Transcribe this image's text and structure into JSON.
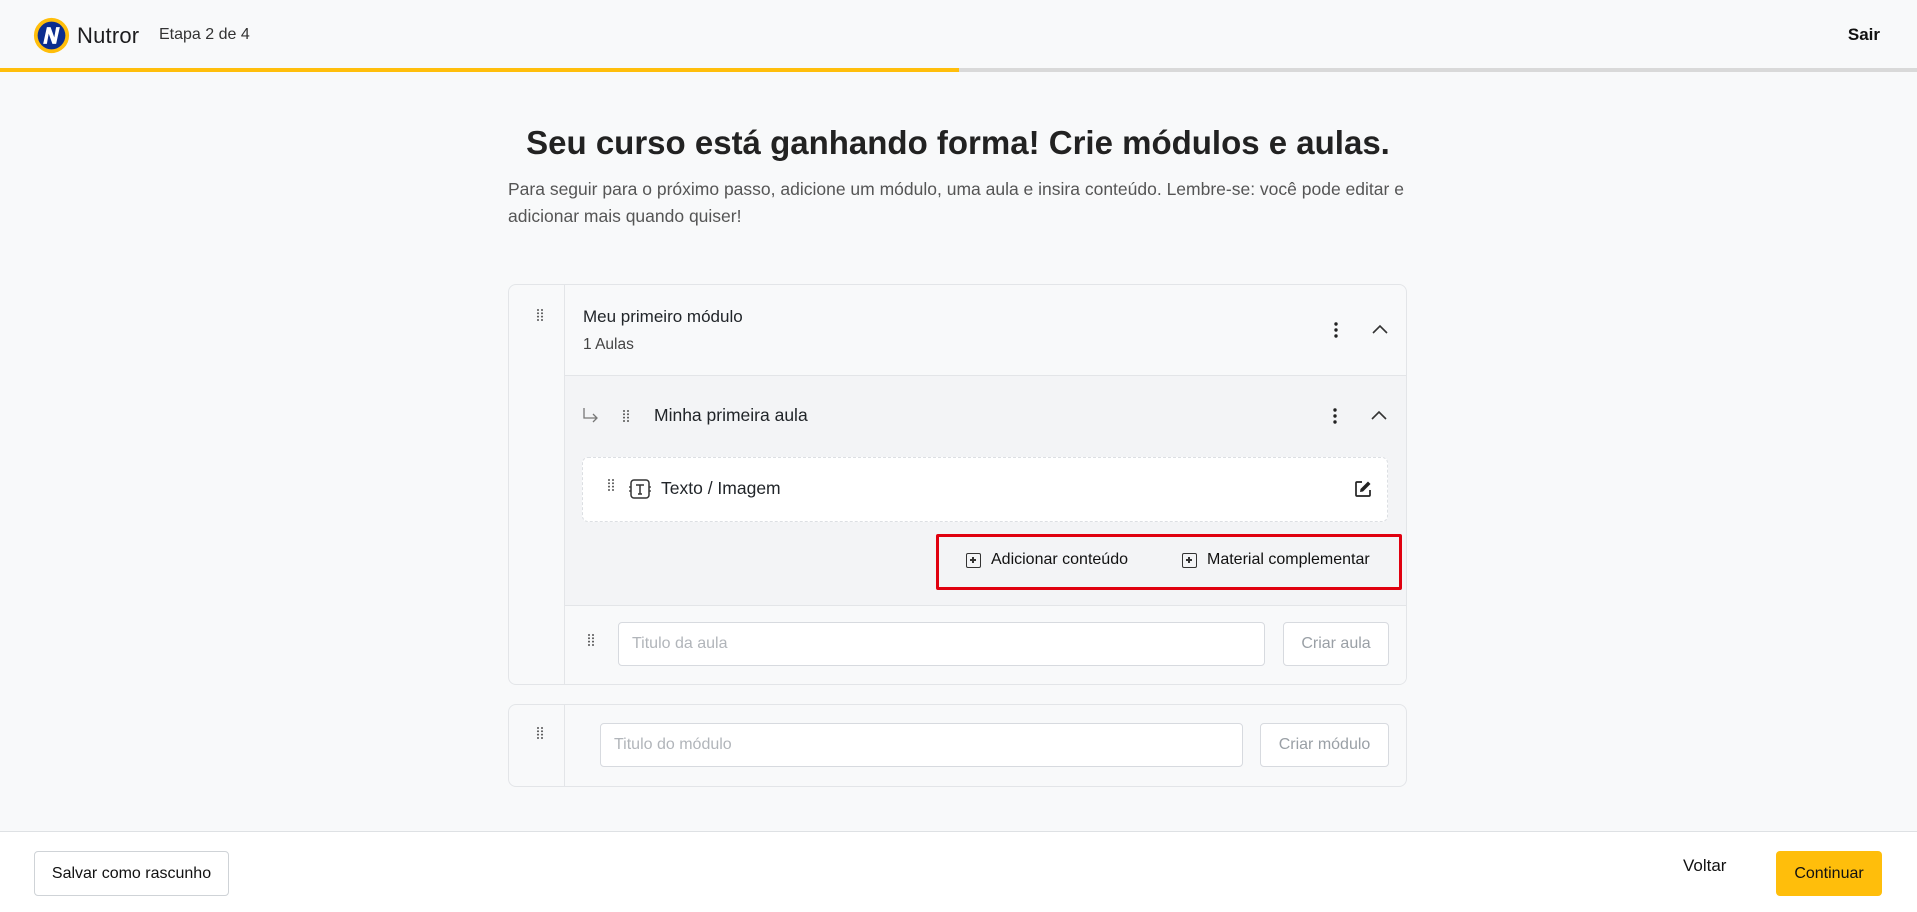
{
  "header": {
    "brand": "Nutror",
    "step": "Etapa 2 de 4",
    "exit_label": "Sair",
    "progress_fraction": 0.5
  },
  "main": {
    "title": "Seu curso está ganhando forma! Crie módulos e aulas.",
    "subtitle": "Para seguir para o próximo passo, adicione um módulo, uma aula e insira conteúdo. Lembre-se: você pode editar e adicionar mais quando quiser!"
  },
  "module": {
    "title": "Meu primeiro módulo",
    "count": "1 Aulas",
    "lesson": {
      "title": "Minha primeira aula",
      "content_item": "Texto / Imagem",
      "add_content_label": "Adicionar conteúdo",
      "supplementary_label": "Material complementar"
    },
    "new_lesson": {
      "placeholder": "Titulo da aula",
      "button_label": "Criar aula"
    }
  },
  "new_module": {
    "placeholder": "Titulo do módulo",
    "button_label": "Criar módulo"
  },
  "footer": {
    "draft_label": "Salvar como rascunho",
    "back_label": "Voltar",
    "continue_label": "Continuar"
  },
  "colors": {
    "accent": "#ffbe0b",
    "highlight": "#e0000f",
    "logo_blue": "#0b2d8f"
  }
}
